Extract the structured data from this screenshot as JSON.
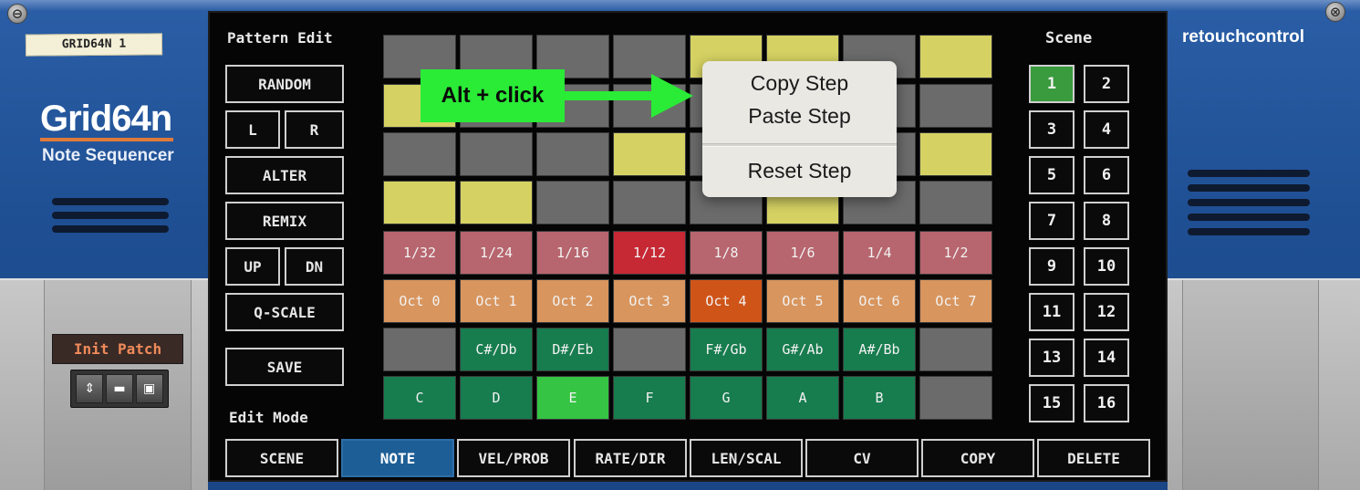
{
  "device": {
    "name_tape": "GRID64N 1",
    "brand": "Grid64n",
    "brand_sub": "Note Sequencer",
    "vendor": "retouchcontrol",
    "patch_name": "Init Patch"
  },
  "pattern_edit": {
    "title": "Pattern Edit",
    "random": "RANDOM",
    "left": "L",
    "right": "R",
    "alter": "ALTER",
    "remix": "REMIX",
    "up": "UP",
    "down": "DN",
    "qscale": "Q-SCALE",
    "save": "SAVE"
  },
  "edit_mode": {
    "title": "Edit Mode",
    "buttons": [
      "SCENE",
      "NOTE",
      "VEL/PROB",
      "RATE/DIR",
      "LEN/SCAL",
      "CV",
      "COPY",
      "DELETE"
    ],
    "selected": "NOTE"
  },
  "scene": {
    "title": "Scene",
    "buttons": [
      "1",
      "2",
      "3",
      "4",
      "5",
      "6",
      "7",
      "8",
      "9",
      "10",
      "11",
      "12",
      "13",
      "14",
      "15",
      "16"
    ],
    "selected": "1"
  },
  "grid": {
    "steps_rows": [
      [
        "off",
        "off",
        "off",
        "off",
        "on",
        "on",
        "off",
        "on"
      ],
      [
        "on",
        "off",
        "off",
        "off",
        "off",
        "off",
        "off",
        "off"
      ],
      [
        "off",
        "off",
        "off",
        "on",
        "off",
        "off",
        "off",
        "on"
      ],
      [
        "on",
        "on",
        "off",
        "off",
        "off",
        "on",
        "off",
        "off"
      ]
    ],
    "rates": [
      "1/32",
      "1/24",
      "1/16",
      "1/12",
      "1/8",
      "1/6",
      "1/4",
      "1/2"
    ],
    "rate_selected": "1/12",
    "octaves": [
      "Oct 0",
      "Oct 1",
      "Oct 2",
      "Oct 3",
      "Oct 4",
      "Oct 5",
      "Oct 6",
      "Oct 7"
    ],
    "octave_selected": "Oct 4",
    "sharps": [
      "",
      "C#/Db",
      "D#/Eb",
      "",
      "F#/Gb",
      "G#/Ab",
      "A#/Bb",
      ""
    ],
    "naturals": [
      "C",
      "D",
      "E",
      "F",
      "G",
      "A",
      "B",
      ""
    ],
    "note_selected": "E"
  },
  "callout": {
    "text": "Alt + click"
  },
  "context_menu": {
    "items": [
      "Copy Step",
      "Paste Step",
      "Reset Step"
    ]
  },
  "colors": {
    "step_on": "#d5d263",
    "step_off": "#6b6b6b",
    "note_selected": "#35c443",
    "callout": "#2aeb36",
    "mode_selected": "#1d5e96"
  }
}
